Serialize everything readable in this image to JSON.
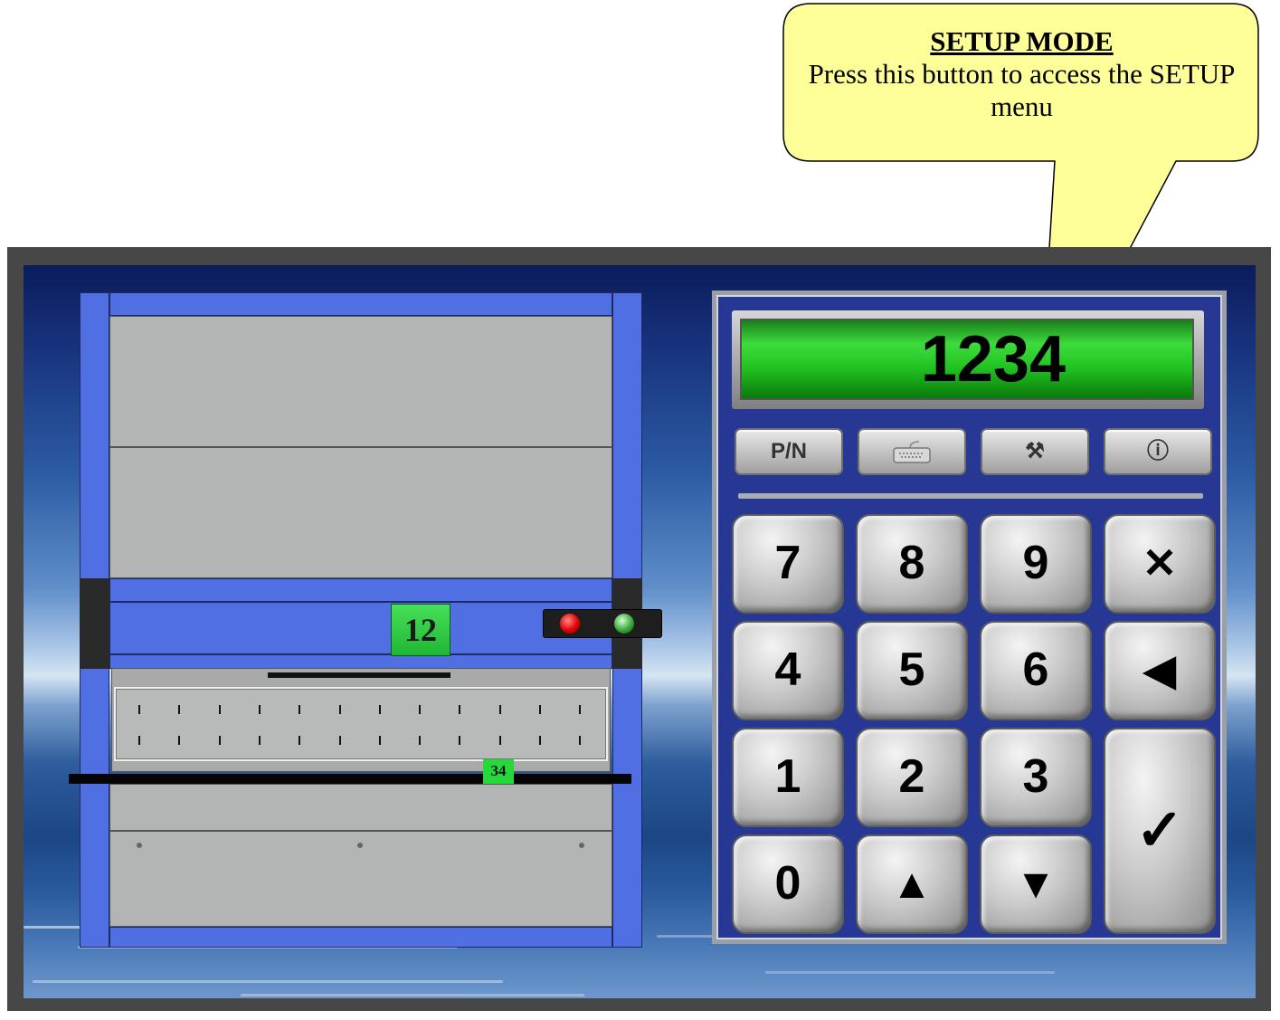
{
  "callout": {
    "title": "SETUP MODE",
    "body": "Press this button to access the SETUP menu",
    "fill": "#ffff99"
  },
  "machine": {
    "tray_code": "12",
    "bin_code": "34",
    "colors": {
      "frame": "#4f6fe3",
      "panel": "#b3b5b4",
      "tray_code_bg": "#26d93a"
    }
  },
  "keypad": {
    "display_value": "1234",
    "function_buttons": [
      {
        "label": "P/N",
        "icon": ""
      },
      {
        "label": "",
        "icon": "keyboard-icon"
      },
      {
        "label": "⚒",
        "icon": "tools-icon"
      },
      {
        "label": "ⓘ",
        "icon": "info-icon"
      }
    ],
    "keys": {
      "k7": "7",
      "k8": "8",
      "k9": "9",
      "clear": "✕",
      "k4": "4",
      "k5": "5",
      "k6": "6",
      "back": "◀",
      "k1": "1",
      "k2": "2",
      "k3": "3",
      "enter": "✓",
      "k0": "0",
      "up": "▲",
      "down": "▼"
    },
    "colors": {
      "body": "#263893",
      "display": "#3ddc3d"
    }
  }
}
